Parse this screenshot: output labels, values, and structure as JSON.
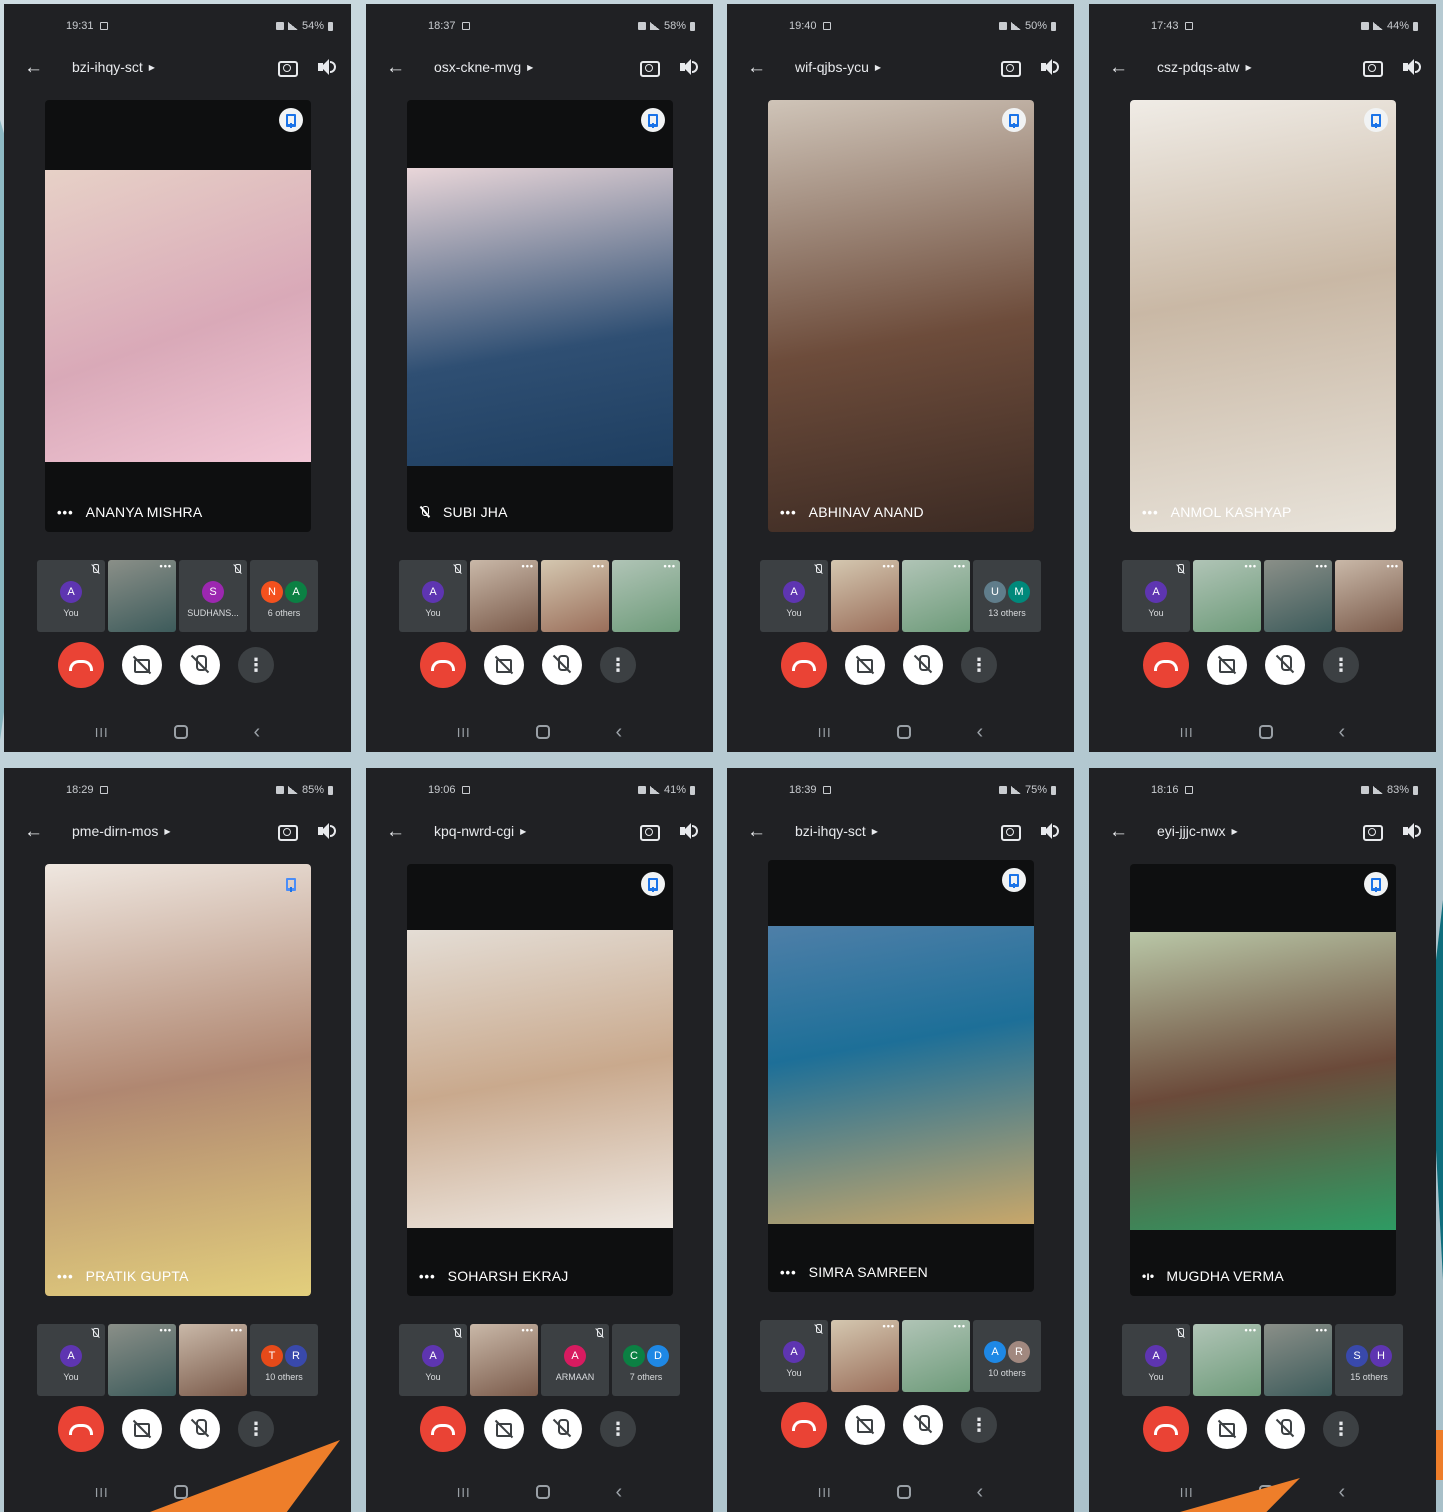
{
  "colors": {
    "end_call": "#ea4335",
    "app_bg": "#202124",
    "thumb_bg": "#3c4043",
    "accent_orange": "#ee7e2a"
  },
  "icons": {
    "back": "arrow-left-icon",
    "switch_camera": "camera-flip-icon",
    "audio": "speaker-icon",
    "pin": "pin-icon",
    "end_call": "phone-hangup-icon",
    "camera": "camera-off-icon",
    "mic": "mic-off-icon",
    "more": "more-vert-icon"
  },
  "phones": [
    {
      "time": "19:31",
      "battery": "54%",
      "meeting_code": "bzi-ihqy-sct",
      "speaker_name": "ANANYA MISHRA",
      "speaker_status": "more",
      "thumbs": [
        {
          "type": "avatar",
          "letters": [
            "A"
          ],
          "colors": [
            "#5e35b1"
          ],
          "label": "You"
        },
        {
          "type": "video"
        },
        {
          "type": "avatar",
          "letters": [
            "S"
          ],
          "colors": [
            "#9c27b0"
          ],
          "label": "SUDHANS..."
        },
        {
          "type": "avatar",
          "letters": [
            "N",
            "A"
          ],
          "colors": [
            "#f4511e",
            "#0b8043"
          ],
          "label": "6 others"
        }
      ]
    },
    {
      "time": "18:37",
      "battery": "58%",
      "meeting_code": "osx-ckne-mvg",
      "speaker_name": "SUBI JHA",
      "speaker_status": "muted",
      "thumbs": [
        {
          "type": "avatar",
          "letters": [
            "A"
          ],
          "colors": [
            "#5e35b1"
          ],
          "label": "You"
        },
        {
          "type": "video"
        },
        {
          "type": "video"
        },
        {
          "type": "video"
        }
      ]
    },
    {
      "time": "19:40",
      "battery": "50%",
      "meeting_code": "wif-qjbs-ycu",
      "speaker_name": "ABHINAV ANAND",
      "speaker_status": "more",
      "thumbs": [
        {
          "type": "avatar",
          "letters": [
            "A"
          ],
          "colors": [
            "#5e35b1"
          ],
          "label": "You"
        },
        {
          "type": "video"
        },
        {
          "type": "video"
        },
        {
          "type": "avatar",
          "letters": [
            "U",
            "M"
          ],
          "colors": [
            "#607d8b",
            "#00897b"
          ],
          "label": "13 others"
        }
      ]
    },
    {
      "time": "17:43",
      "battery": "44%",
      "meeting_code": "csz-pdqs-atw",
      "speaker_name": "ANMOL KASHYAP",
      "speaker_status": "more",
      "thumbs": [
        {
          "type": "avatar",
          "letters": [
            "A"
          ],
          "colors": [
            "#5e35b1"
          ],
          "label": "You"
        },
        {
          "type": "video"
        },
        {
          "type": "video"
        },
        {
          "type": "video"
        }
      ]
    },
    {
      "time": "18:29",
      "battery": "85%",
      "meeting_code": "pme-dirn-mos",
      "speaker_name": "PRATIK GUPTA",
      "speaker_status": "more",
      "thumbs": [
        {
          "type": "avatar",
          "letters": [
            "A"
          ],
          "colors": [
            "#5e35b1"
          ],
          "label": "You"
        },
        {
          "type": "video"
        },
        {
          "type": "video"
        },
        {
          "type": "avatar",
          "letters": [
            "T",
            "R"
          ],
          "colors": [
            "#e64a19",
            "#3949ab"
          ],
          "label": "10 others"
        }
      ]
    },
    {
      "time": "19:06",
      "battery": "41%",
      "meeting_code": "kpq-nwrd-cgi",
      "speaker_name": "SOHARSH EKRAJ",
      "speaker_status": "more",
      "thumbs": [
        {
          "type": "avatar",
          "letters": [
            "A"
          ],
          "colors": [
            "#5e35b1"
          ],
          "label": "You"
        },
        {
          "type": "video"
        },
        {
          "type": "avatar",
          "letters": [
            "A"
          ],
          "colors": [
            "#d81b60"
          ],
          "label": "ARMAAN"
        },
        {
          "type": "avatar",
          "letters": [
            "C",
            "D"
          ],
          "colors": [
            "#0b8043",
            "#1e88e5"
          ],
          "label": "7 others"
        }
      ]
    },
    {
      "time": "18:39",
      "battery": "75%",
      "meeting_code": "bzi-ihqy-sct",
      "speaker_name": "SIMRA SAMREEN",
      "speaker_status": "more",
      "thumbs": [
        {
          "type": "avatar",
          "letters": [
            "A"
          ],
          "colors": [
            "#5e35b1"
          ],
          "label": "You"
        },
        {
          "type": "video"
        },
        {
          "type": "video"
        },
        {
          "type": "avatar",
          "letters": [
            "A",
            "R"
          ],
          "colors": [
            "#1e88e5",
            "#a1887f"
          ],
          "label": "10 others"
        }
      ]
    },
    {
      "time": "18:16",
      "battery": "83%",
      "meeting_code": "eyi-jjjc-nwx",
      "speaker_name": "MUGDHA VERMA",
      "speaker_status": "speaking",
      "thumbs": [
        {
          "type": "avatar",
          "letters": [
            "A"
          ],
          "colors": [
            "#5e35b1"
          ],
          "label": "You"
        },
        {
          "type": "video"
        },
        {
          "type": "video"
        },
        {
          "type": "avatar",
          "letters": [
            "S",
            "H"
          ],
          "colors": [
            "#3949ab",
            "#5e35b1"
          ],
          "label": "15 others"
        }
      ]
    }
  ]
}
